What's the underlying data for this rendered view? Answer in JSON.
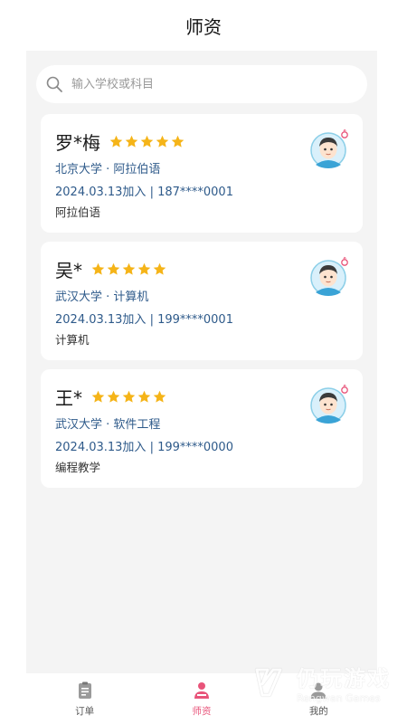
{
  "header": {
    "title": "师资"
  },
  "search": {
    "placeholder": "输入学校或科目",
    "icon": "search-icon"
  },
  "teachers": [
    {
      "name": "罗*梅",
      "rating": 5,
      "school_line": "北京大学 · 阿拉伯语",
      "joined_line": "2024.03.13加入 | 187****0001",
      "subject": "阿拉伯语"
    },
    {
      "name": "吴*",
      "rating": 5,
      "school_line": "武汉大学 · 计算机",
      "joined_line": "2024.03.13加入 | 199****0001",
      "subject": "计算机"
    },
    {
      "name": "王*",
      "rating": 5,
      "school_line": "武汉大学 · 软件工程",
      "joined_line": "2024.03.13加入 | 199****0000",
      "subject": "编程教学"
    }
  ],
  "tabbar": {
    "tabs": [
      {
        "label": "订单",
        "icon": "clipboard-icon",
        "active": false
      },
      {
        "label": "师资",
        "icon": "teacher-icon",
        "active": true
      },
      {
        "label": "我的",
        "icon": "user-icon",
        "active": false
      }
    ]
  },
  "watermark": {
    "text_cn": "仍玩游戏",
    "text_en": "Rengwan Games"
  },
  "colors": {
    "accent": "#e8547a",
    "star": "#f5b418",
    "meta_text": "#2e5a8a",
    "background": "#f4f4f4"
  }
}
